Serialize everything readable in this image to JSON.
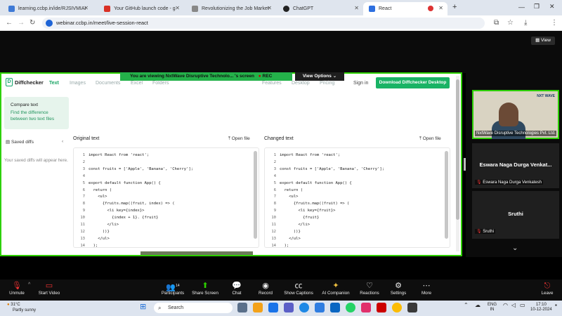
{
  "browser": {
    "tabs": [
      {
        "label": "learning.ccbp.in/ide/RJSIVMIAI",
        "color": "#3f7ad6"
      },
      {
        "label": "Your GitHub launch code - g",
        "color": "#d93025"
      },
      {
        "label": "Revolutionizing the Job Market",
        "color": "#777777"
      },
      {
        "label": "ChatGPT",
        "color": "#222222"
      },
      {
        "label": "React",
        "color": "#2d6fe0"
      }
    ],
    "url": "webinar.ccbp.in/meet/live-session-react",
    "new_tab": "+",
    "profile": "E"
  },
  "zoom": {
    "view_label": "View",
    "banner_text": "You are viewing  NxtWave Disruptive Technolo... 's screen",
    "rec_label": "REC",
    "view_options": "View Options"
  },
  "diffchecker": {
    "brand": "Diffchecker",
    "nav": [
      "Text",
      "Images",
      "Documents",
      "Excel",
      "Folders"
    ],
    "right_nav": [
      "Features",
      "Desktop",
      "Pricing"
    ],
    "sign_in": "Sign in",
    "download": "Download Diffchecker Desktop",
    "compare_title": "Compare text",
    "compare_desc": "Find the difference between two text files",
    "saved_diffs": "Saved diffs",
    "saved_msg": "Your saved diffs will appear here.",
    "original_title": "Original text",
    "changed_title": "Changed text",
    "open_file": "Open file",
    "original_code": [
      "import React from 'react';",
      "",
      "const fruits = ['Apple', 'Banana', 'Cherry'];",
      "",
      "export default function App() {",
      "  return (",
      "    <ul>",
      "      {fruits.map((fruit, index) => (",
      "        <li key={index}>",
      "          {index + 1}. {fruit}",
      "        </li>",
      "      ))}",
      "    </ul>",
      "  );"
    ],
    "changed_code": [
      "import React from 'react';",
      "",
      "const fruits = ['Apple', 'Banana', 'Cherry'];",
      "",
      "export default function App() {",
      "  return (",
      "    <ul>",
      "      {fruits.map((fruit) => (",
      "        <li key={fruit}>",
      "          {fruit}",
      "        </li>",
      "      ))}",
      "    </ul>",
      "  );"
    ]
  },
  "participants_panel": {
    "presenter_caption": "NxtWave Disruptive Technologies Pvt. Ltd.",
    "presenter_logo": "NXT WAVE",
    "p2_title": "Eswara Naga Durga Venkat...",
    "p2_sub": "Eswara Naga Durga Venkatesh",
    "p3_title": "Sruthi",
    "p3_sub": "Sruthi"
  },
  "meeting_bar": {
    "unmute": "Unmute",
    "start_video": "Start Video",
    "participants": "Participants",
    "participants_count": "14",
    "share_screen": "Share Screen",
    "chat": "Chat",
    "record": "Record",
    "show_captions": "Show Captions",
    "ai_companion": "AI Companion",
    "reactions": "Reactions",
    "settings": "Settings",
    "more": "More",
    "leave": "Leave"
  },
  "taskbar": {
    "weather_temp": "31°C",
    "weather_desc": "Partly sunny",
    "search": "Search",
    "lang": "ENG",
    "region": "IN",
    "time": "17:10",
    "date": "10-12-2024"
  }
}
